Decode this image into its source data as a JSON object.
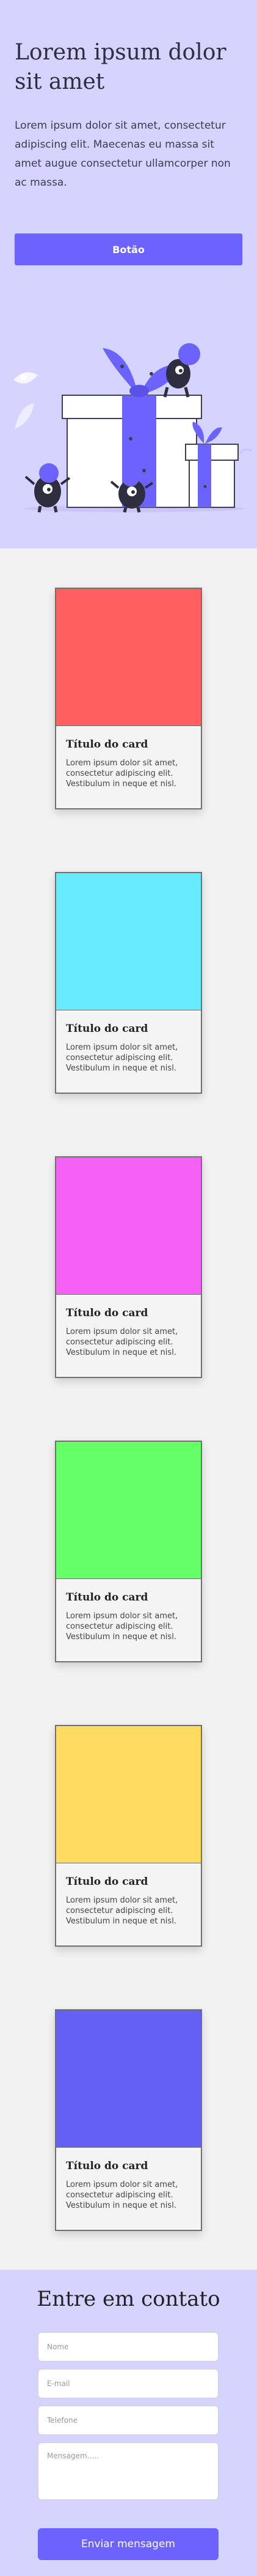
{
  "hero": {
    "title": "Lorem ipsum dolor sit amet",
    "text": "Lorem ipsum dolor sit amet, consectetur adipiscing elit. Maecenas eu massa sit amet augue consectetur ullamcorper non ac massa.",
    "button_label": "Botão"
  },
  "colors": {
    "accent": "#6c63ff",
    "hero_background": "#d5d3ff",
    "page_background": "#f2f2f2"
  },
  "cards": [
    {
      "color": "#ff5f5f",
      "title": "Título do card",
      "text": "Lorem ipsum dolor sit amet, consectetur adipiscing elit. Vestibulum in neque et nisl."
    },
    {
      "color": "#66ebff",
      "title": "Título do card",
      "text": "Lorem ipsum dolor sit amet, consectetur adipiscing elit. Vestibulum in neque et nisl."
    },
    {
      "color": "#f561f5",
      "title": "Título do card",
      "text": "Lorem ipsum dolor sit amet, consectetur adipiscing elit. Vestibulum in neque et nisl."
    },
    {
      "color": "#65ff67",
      "title": "Título do card",
      "text": "Lorem ipsum dolor sit amet, consectetur adipiscing elit. Vestibulum in neque et nisl."
    },
    {
      "color": "#ffdc5f",
      "title": "Título do card",
      "text": "Lorem ipsum dolor sit amet, consectetur adipiscing elit. Vestibulum in neque et nisl."
    },
    {
      "color": "#6560f5",
      "title": "Título do card",
      "text": "Lorem ipsum dolor sit amet, consectetur adipiscing elit. Vestibulum in neque et nisl."
    }
  ],
  "contact": {
    "title": "Entre em contato",
    "name_placeholder": "Nome",
    "email_placeholder": "E-mail",
    "phone_placeholder": "Telefone",
    "message_placeholder": "Mensagem.....",
    "send_label": "Enviar mensagem"
  }
}
